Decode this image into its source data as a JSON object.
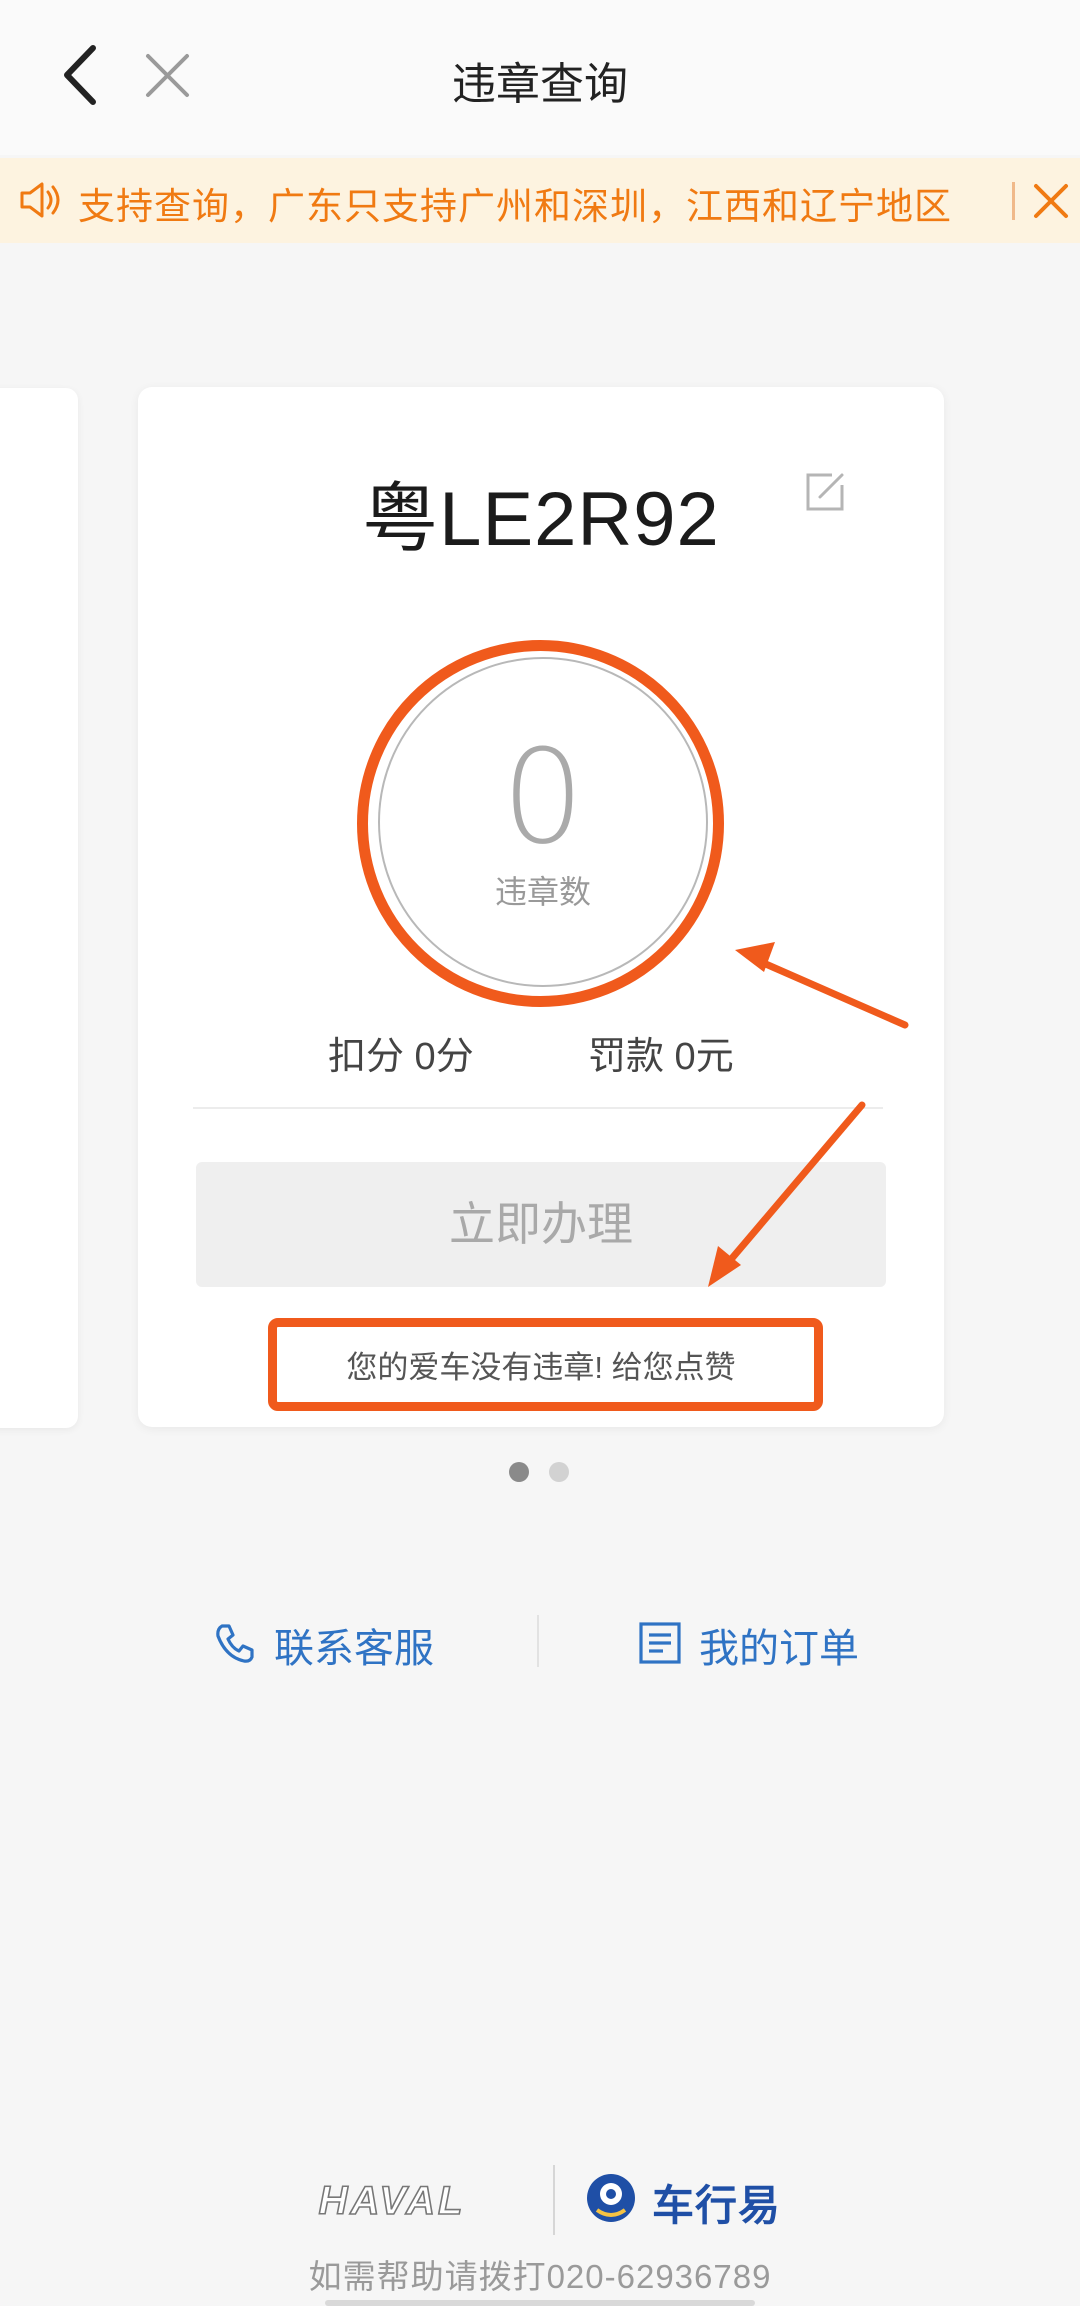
{
  "header": {
    "title": "违章查询",
    "back_icon": "chevron-left-icon",
    "close_icon": "close-icon"
  },
  "notice": {
    "text": "支持查询，广东只支持广州和深圳，江西和辽宁地区",
    "icon": "speaker-icon",
    "close_icon": "close-icon",
    "color": "#f07a12",
    "background": "#fdf3e0"
  },
  "card": {
    "plate": "粤LE2R92",
    "edit_icon": "edit-icon",
    "violation_count": "0",
    "violation_label": "违章数",
    "points": "扣分 0分",
    "fine": "罚款 0元",
    "action_button": "立即办理",
    "message": "您的爱车没有违章! 给您点赞"
  },
  "pagination": {
    "total": 2,
    "active_index": 0
  },
  "links": {
    "contact": "联系客服",
    "orders": "我的订单",
    "color": "#2f73c4"
  },
  "footer": {
    "brand": "HAVAL",
    "partner": "车行易",
    "help": "如需帮助请拨打020-62936789"
  },
  "annotation_color": "#f05a1c"
}
